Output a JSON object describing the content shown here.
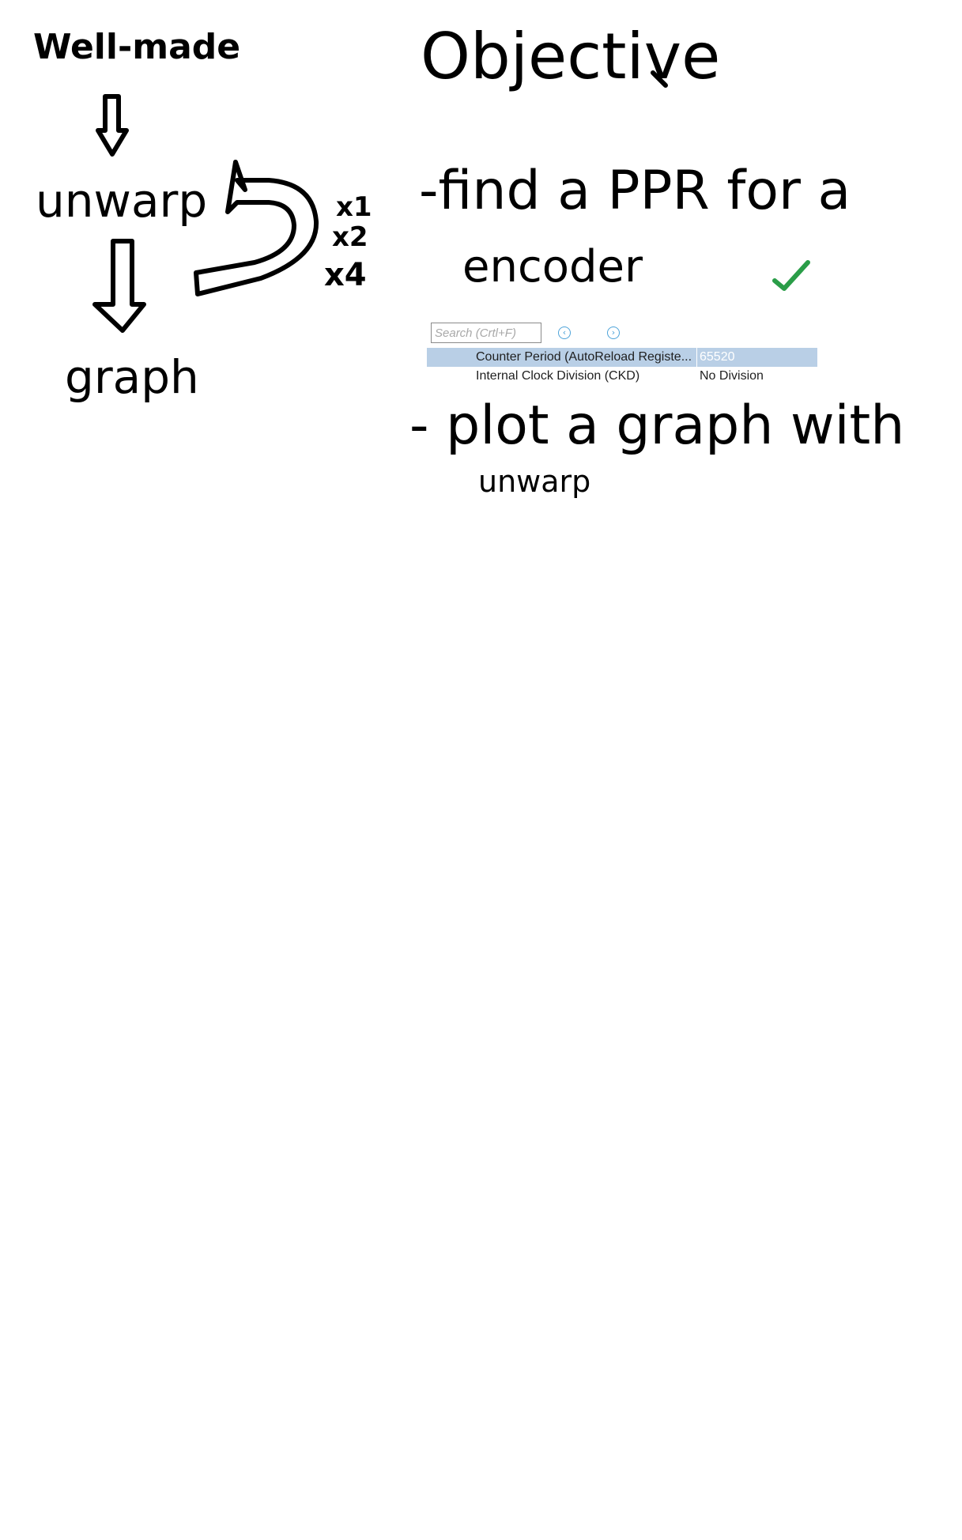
{
  "left_notes": {
    "title": "Well-made",
    "step": "unwarp",
    "result": "graph",
    "multipliers": [
      "x1",
      "x2",
      "x4"
    ]
  },
  "objective": {
    "heading": "Objective",
    "task1_line1": "-find a PPR for a",
    "task1_line2": "encoder",
    "task1_status": "✓",
    "task2_main": "- plot a graph with",
    "task2_sub": "unwarp"
  },
  "cube_panel": {
    "search_placeholder": "Search (Crtl+F)",
    "prev_icon": "‹",
    "next_icon": "›",
    "rows": [
      {
        "name": "Counter Period (AutoReload Registe...",
        "value": "65520",
        "selected": true
      },
      {
        "name": "Internal Clock Division (CKD)",
        "value": "No Division",
        "selected": false
      }
    ]
  },
  "colors": {
    "ink": "#000000",
    "check": "#2a9d48",
    "selection": "#b9cfe6",
    "nav_icon": "#4da3d9"
  }
}
